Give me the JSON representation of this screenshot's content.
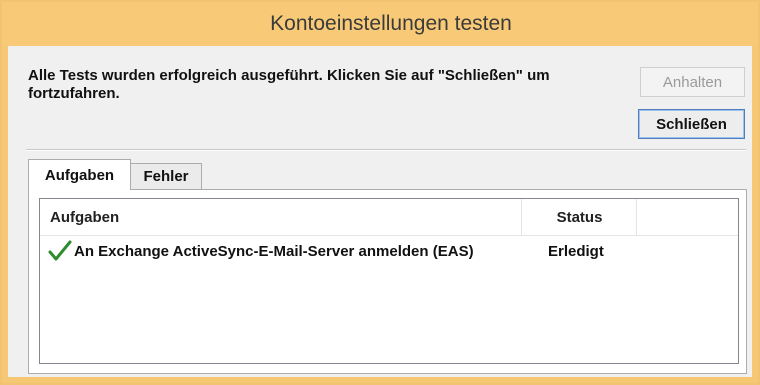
{
  "window": {
    "title": "Kontoeinstellungen testen"
  },
  "message": "Alle Tests wurden erfolgreich ausgeführt. Klicken Sie auf \"Schließen\" um fortzufahren.",
  "buttons": {
    "stop_label": "Anhalten",
    "close_label": "Schließen"
  },
  "tabs": [
    {
      "label": "Aufgaben",
      "selected": true
    },
    {
      "label": "Fehler",
      "selected": false
    }
  ],
  "table": {
    "columns": [
      "Aufgaben",
      "Status"
    ],
    "rows": [
      {
        "icon": "check-icon",
        "task": "An Exchange ActiveSync-E-Mail-Server anmelden (EAS)",
        "status": "Erledigt"
      }
    ]
  },
  "colors": {
    "titlebar": "#f8ca77",
    "check": "#2e8b2e"
  }
}
